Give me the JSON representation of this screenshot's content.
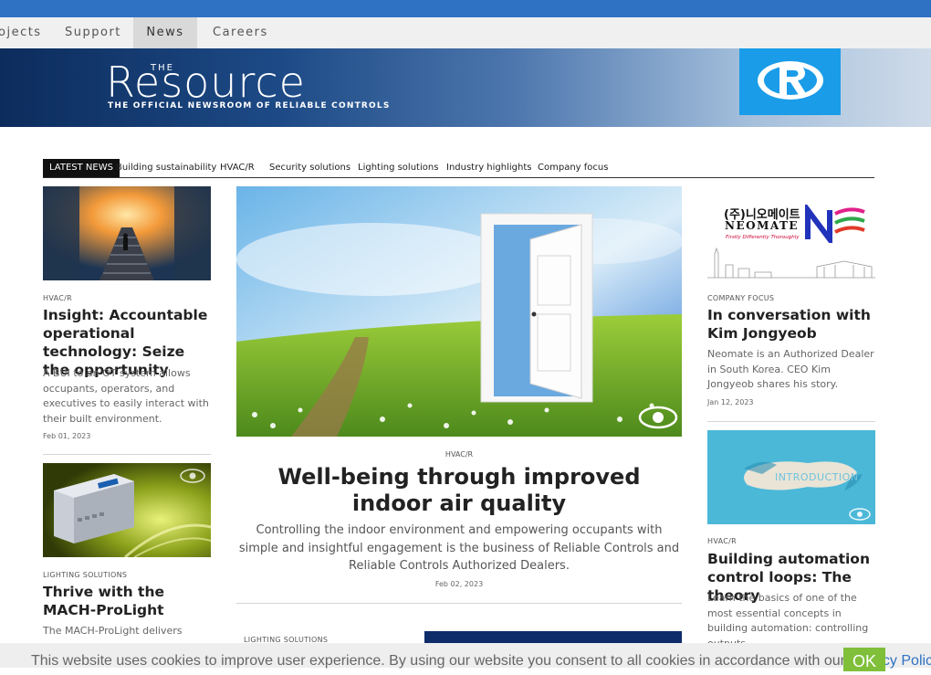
{
  "nav": {
    "items": [
      {
        "label": "ojects"
      },
      {
        "label": "Support"
      },
      {
        "label": "News"
      },
      {
        "label": "Careers"
      }
    ]
  },
  "banner": {
    "logo_the": "THE",
    "logo_main": "Resource",
    "logo_sub": "THE OFFICIAL NEWSROOM OF RELIABLE CONTROLS"
  },
  "tabs": [
    {
      "label": "LATEST NEWS"
    },
    {
      "label": "Building sustainability"
    },
    {
      "label": "HVAC/R"
    },
    {
      "label": "Security solutions"
    },
    {
      "label": "Lighting solutions"
    },
    {
      "label": "Industry highlights"
    },
    {
      "label": "Company focus"
    }
  ],
  "left": {
    "article1": {
      "category": "HVAC/R",
      "title": "Insight: Accountable operational technology: Seize the opportunity",
      "desc": "A BUI to an OT system allows occupants, operators, and executives to easily interact with their built environment.",
      "date": "Feb 01, 2023"
    },
    "article2": {
      "category": "LIGHTING SOLUTIONS",
      "title": "Thrive with the MACH-ProLight",
      "desc": "The MACH-ProLight delivers"
    }
  },
  "hero": {
    "category": "HVAC/R",
    "title": "Well-being through improved indoor air quality",
    "desc": "Controlling the indoor environment and empowering occupants with simple and insightful engagement is the business of Reliable Controls and Reliable Controls Authorized Dealers.",
    "date": "Feb 02, 2023",
    "next_category": "LIGHTING SOLUTIONS"
  },
  "right": {
    "neomate": {
      "korean": "(주)니오메이트",
      "brand": "NEOMATE",
      "tagline": "Firstly Differently Thoroughly"
    },
    "article1": {
      "category": "COMPANY FOCUS",
      "title": "In conversation with Kim Jongyeob",
      "desc": "Neomate is an Authorized Dealer in South Korea. CEO Kim Jongyeob shares his story.",
      "date": "Jan 12, 2023"
    },
    "intro_label": "INTRODUCTION",
    "article2": {
      "category": "HVAC/R",
      "title": "Building automation control loops: The theory",
      "desc": "Learn the basics of one of the most essential concepts in building automation: controlling outputs"
    }
  },
  "cookie": {
    "text": "This website uses cookies to improve user experience. By using our website you consent to all cookies in accordance with our",
    "link": "Privacy Policy",
    "after": ".",
    "ok": "OK"
  },
  "colors": {
    "accent": "#2f72c4",
    "brand_blue": "#1a9ce8",
    "ok_green": "#7fbf3a"
  }
}
